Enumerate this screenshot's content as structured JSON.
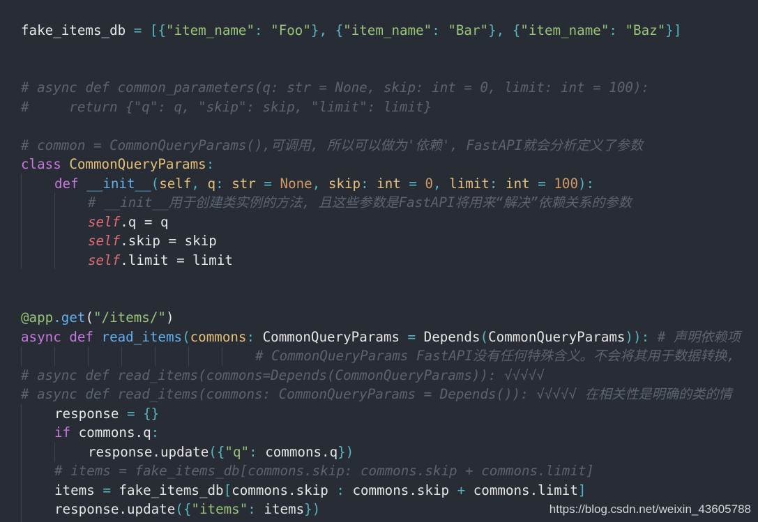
{
  "editor": {
    "background": "#282c34",
    "theme_colors": {
      "keyword": "#c678dd",
      "function": "#61afef",
      "class": "#e5c07b",
      "string": "#98c379",
      "number": "#d19a66",
      "comment": "#5c6370",
      "self": "#e06c75"
    }
  },
  "lines": {
    "l1_var": "fake_items_db",
    "l1_eq": " = ",
    "l1_lb": "[",
    "l1_o1": "{",
    "l1_k1": "\"item_name\"",
    "l1_c1": ": ",
    "l1_v1": "\"Foo\"",
    "l1_e1": "}, ",
    "l1_o2": "{",
    "l1_k2": "\"item_name\"",
    "l1_c2": ": ",
    "l1_v2": "\"Bar\"",
    "l1_e2": "}, ",
    "l1_o3": "{",
    "l1_k3": "\"item_name\"",
    "l1_c3": ": ",
    "l1_v3": "\"Baz\"",
    "l1_e3": "}",
    "l1_rb": "]",
    "c1": "# async def common_parameters(q: str = None, skip: int = 0, limit: int = 100):",
    "c2": "#     return {\"q\": q, \"skip\": skip, \"limit\": limit}",
    "c3": "# common = CommonQueryParams(),可调用, 所以可以做为'依赖', FastAPI就会分析定义了参数",
    "class_kw": "class ",
    "class_name": "CommonQueryParams",
    "class_colon": ":",
    "init_def": "def ",
    "init_name": "__init__",
    "init_lp": "(",
    "init_self": "self",
    "init_comma1": ", ",
    "init_q": "q",
    "init_colon1": ": ",
    "init_str": "str",
    "init_eq1": " = ",
    "init_none": "None",
    "init_comma2": ", ",
    "init_skip": "skip",
    "init_colon2": ": ",
    "init_int1": "int",
    "init_eq2": " = ",
    "init_zero": "0",
    "init_comma3": ", ",
    "init_limit": "limit",
    "init_colon3": ": ",
    "init_int2": "int",
    "init_eq3": " = ",
    "init_hundred": "100",
    "init_rp": "):",
    "c4": "# __init__用于创建类实例的方法, 且这些参数是FastAPI将用来“解决”依赖关系的参数",
    "s1_self": "self",
    "s1_rest": ".q = q",
    "s2_self": "self",
    "s2_rest": ".skip = skip",
    "s3_self": "self",
    "s3_rest": ".limit = limit",
    "deco_at": "@app",
    "deco_get": ".get",
    "deco_lp": "(",
    "deco_str": "\"/items/\"",
    "deco_rp": ")",
    "ri_async": "async ",
    "ri_def": "def ",
    "ri_name": "read_items",
    "ri_lp": "(",
    "ri_param": "commons",
    "ri_colon": ": ",
    "ri_type": "CommonQueryParams",
    "ri_eq": " = ",
    "ri_depends": "Depends",
    "ri_lp2": "(",
    "ri_arg": "CommonQueryParams",
    "ri_rp": ")):",
    "ri_comment": " # 声明依赖项",
    "c5": "# CommonQueryParams FastAPI没有任何特殊含义。不会将其用于数据转换,",
    "c6": "# async def read_items(commons=Depends(CommonQueryParams)): √√√√√",
    "c7": "# async def read_items(commons: CommonQueryParams = Depends()): √√√√√ 在相关性是明确的类的情",
    "r1_var": "response",
    "r1_eq": " = ",
    "r1_val": "{}",
    "if_kw": "if ",
    "if_obj": "commons",
    "if_attr": ".q",
    "if_colon": ":",
    "u1_obj": "response",
    "u1_meth": ".update",
    "u1_lp": "(",
    "u1_lb": "{",
    "u1_key": "\"q\"",
    "u1_colon": ": ",
    "u1_val": "commons.q",
    "u1_rb": "}",
    "u1_rp": ")",
    "c8": "# items = fake_items_db[commons.skip: commons.skip + commons.limit]",
    "it_var": "items",
    "it_eq": " = ",
    "it_src": "fake_items_db",
    "it_lb": "[",
    "it_a": "commons.skip",
    "it_colon": " : ",
    "it_b": "commons.skip",
    "it_plus": " + ",
    "it_c": "commons.limit",
    "it_rb": "]",
    "u2_obj": "response",
    "u2_meth": ".update",
    "u2_lp": "(",
    "u2_lb": "{",
    "u2_key": "\"items\"",
    "u2_colon": ": ",
    "u2_val": "items",
    "u2_rb": "}",
    "u2_rp": ")"
  },
  "watermark": "https://blog.csdn.net/weixin_43605788"
}
